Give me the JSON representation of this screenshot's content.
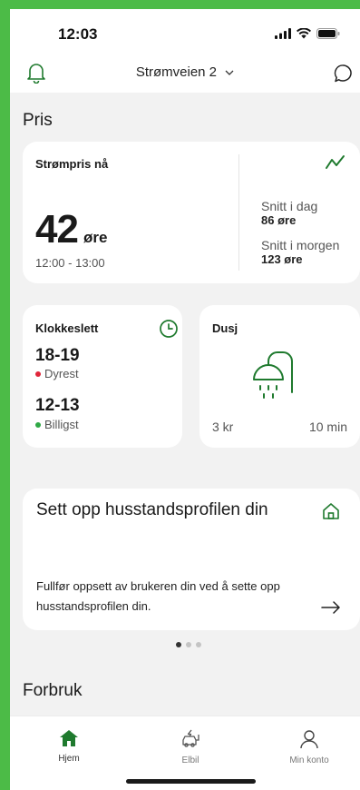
{
  "colors": {
    "brand_green": "#1f7a2e",
    "frame_green": "#4cbb47",
    "expensive_red": "#e0263a",
    "cheap_green": "#2fa845"
  },
  "status": {
    "time": "12:03",
    "icons": [
      "signal-icon",
      "wifi-icon",
      "battery-icon"
    ]
  },
  "header": {
    "address": "Strømveien 2",
    "left_icon": "bell-icon",
    "right_icon": "chat-bubble-icon"
  },
  "sections": {
    "price": "Pris",
    "consumption": "Forbruk"
  },
  "price_now": {
    "label": "Strømpris nå",
    "value": "42",
    "unit": "øre",
    "time_range": "12:00 - 13:00",
    "icon": "trend-up-icon",
    "avg_today_label": "Snitt i dag",
    "avg_today_value": "86 øre",
    "avg_tomorrow_label": "Snitt i morgen",
    "avg_tomorrow_value": "123 øre"
  },
  "clock_card": {
    "label": "Klokkeslett",
    "icon": "clock-icon",
    "expensive_time": "18-19",
    "expensive_label": "Dyrest",
    "cheap_time": "12-13",
    "cheap_label": "Billigst"
  },
  "shower_card": {
    "label": "Dusj",
    "icon": "shower-icon",
    "cost": "3 kr",
    "duration": "10 min"
  },
  "profile_card": {
    "title": "Sett opp husstandsprofilen din",
    "text": "Fullfør oppsett av brukeren din ved å sette opp husstandsprofilen din.",
    "icon": "house-icon",
    "arrow": "arrow-right-icon"
  },
  "pager": {
    "count": 3,
    "active": 1
  },
  "tabs": [
    {
      "label": "Hjem",
      "icon": "home-icon",
      "active": true
    },
    {
      "label": "Elbil",
      "icon": "car-charger-icon",
      "active": false
    },
    {
      "label": "Min konto",
      "icon": "user-icon",
      "active": false
    }
  ]
}
